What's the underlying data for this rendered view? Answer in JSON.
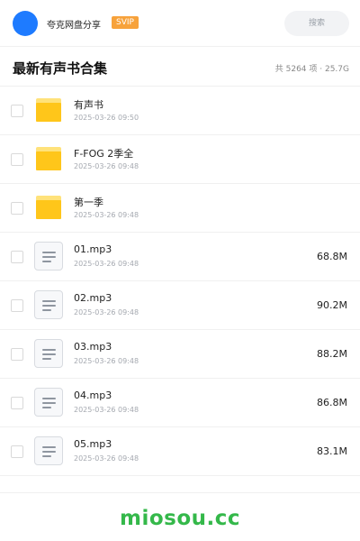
{
  "header": {
    "share_name": "夸克网盘分享",
    "badge": "SVIP",
    "search_placeholder": "搜索"
  },
  "folder": {
    "title": "最新有声书合集",
    "summary": "共 5264 项 · 25.7G"
  },
  "items": [
    {
      "type": "folder",
      "name": "有声书",
      "date": "2025-03-26 09:50",
      "size": ""
    },
    {
      "type": "folder",
      "name": "F-FOG 2季全",
      "date": "2025-03-26 09:48",
      "size": ""
    },
    {
      "type": "folder",
      "name": "第一季",
      "date": "2025-03-26 09:48",
      "size": ""
    },
    {
      "type": "file",
      "name": "01.mp3",
      "date": "2025-03-26 09:48",
      "size": "68.8M"
    },
    {
      "type": "file",
      "name": "02.mp3",
      "date": "2025-03-26 09:48",
      "size": "90.2M"
    },
    {
      "type": "file",
      "name": "03.mp3",
      "date": "2025-03-26 09:48",
      "size": "88.2M"
    },
    {
      "type": "file",
      "name": "04.mp3",
      "date": "2025-03-26 09:48",
      "size": "86.8M"
    },
    {
      "type": "file",
      "name": "05.mp3",
      "date": "2025-03-26 09:48",
      "size": "83.1M"
    }
  ],
  "watermark": "miosou.cc",
  "colors": {
    "avatar": "#1e7bff",
    "badge": "#f7a23b",
    "folder": "#ffc61a",
    "watermark": "#34b84a"
  }
}
